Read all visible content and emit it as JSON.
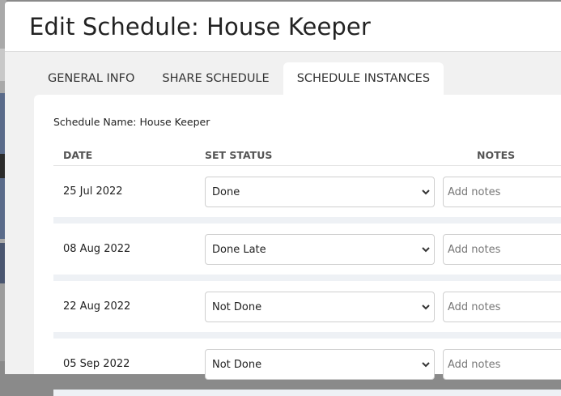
{
  "modal": {
    "title": "Edit Schedule: House Keeper"
  },
  "tabs": [
    {
      "label": "GENERAL INFO",
      "active": false
    },
    {
      "label": "SHARE SCHEDULE",
      "active": false
    },
    {
      "label": "SCHEDULE INSTANCES",
      "active": true
    }
  ],
  "schedule": {
    "name_label": "Schedule Name: House Keeper"
  },
  "table": {
    "headers": {
      "date": "DATE",
      "status": "SET STATUS",
      "notes": "NOTES"
    },
    "rows": [
      {
        "date": "25 Jul 2022",
        "status": "Done",
        "notes_placeholder": "Add notes"
      },
      {
        "date": "08 Aug 2022",
        "status": "Done Late",
        "notes_placeholder": "Add notes"
      },
      {
        "date": "22 Aug 2022",
        "status": "Not Done",
        "notes_placeholder": "Add notes"
      },
      {
        "date": "05 Sep 2022",
        "status": "Not Done",
        "notes_placeholder": "Add notes"
      }
    ]
  },
  "colors": {
    "overlay": "#8a8a8a",
    "body_bg": "#f1f1f1",
    "row_divider": "#eef1f5"
  }
}
